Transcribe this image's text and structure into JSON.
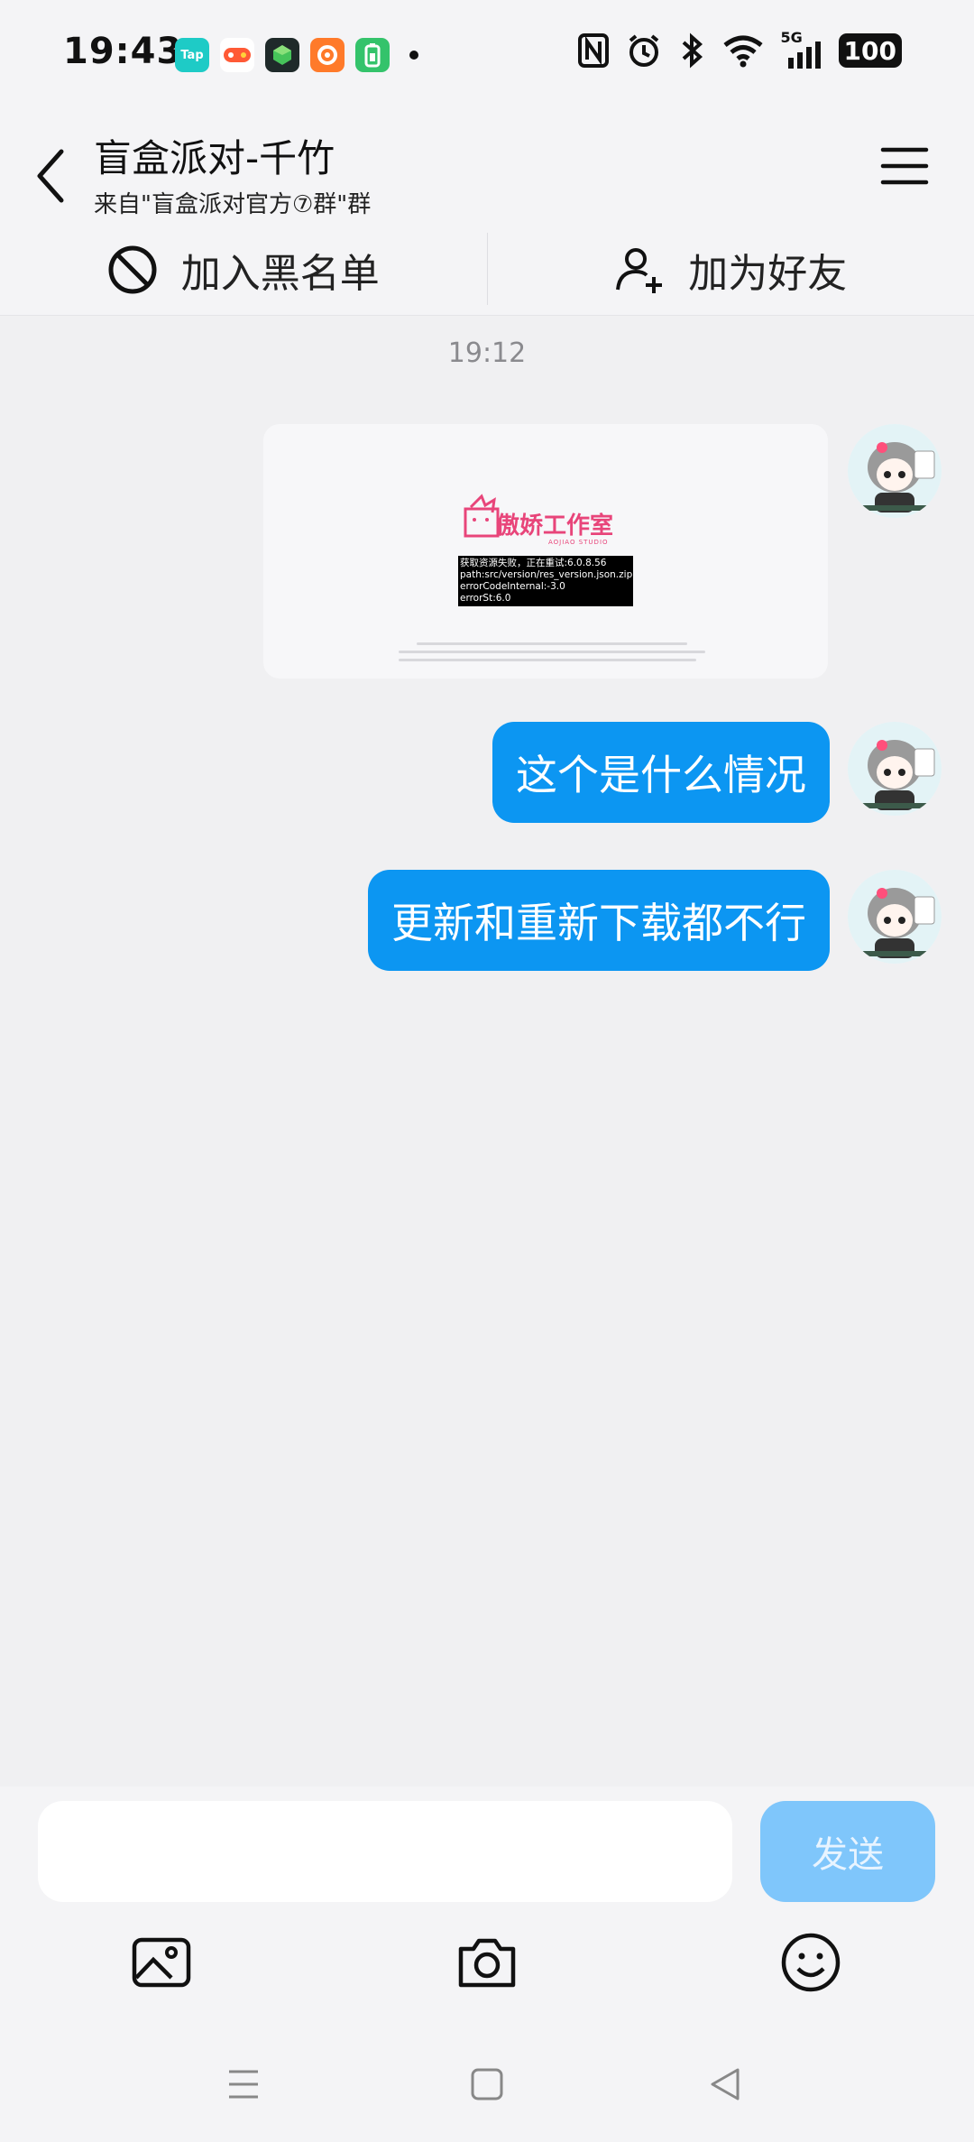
{
  "status_bar": {
    "time": "19:43",
    "notif_apps": [
      {
        "label": "Tap",
        "color": "#1ecbc6"
      },
      {
        "label": "",
        "color": "#ff5a36"
      },
      {
        "label": "",
        "color": "#1f2a2a"
      },
      {
        "label": "",
        "color": "#ff7a2a"
      },
      {
        "label": "",
        "color": "#34c36b"
      }
    ],
    "network": "5G",
    "battery": "100"
  },
  "header": {
    "title": "盲盒派对-千竹",
    "subtitle": "来自\"盲盒派对官方⑦群\"群"
  },
  "actions": {
    "blacklist_label": "加入黑名单",
    "add_friend_label": "加为好友"
  },
  "chat": {
    "timestamp": "19:12",
    "image_message": {
      "brand": "傲娇工作室",
      "brand_sub": "AOJIAO STUDIO",
      "error_lines": [
        "获取资源失败，正在重试:6.0.8.56",
        "path:src/version/res_version.json.zip",
        "errorCodeInternal:-3.0",
        "errorSt:6.0"
      ]
    },
    "messages": [
      {
        "text": "这个是什么情况"
      },
      {
        "text": "更新和重新下载都不行"
      }
    ]
  },
  "input": {
    "value": "",
    "send_label": "发送"
  },
  "colors": {
    "bubble": "#0c96f2",
    "send_disabled": "#7fc6fb",
    "background": "#f0f0f2"
  }
}
